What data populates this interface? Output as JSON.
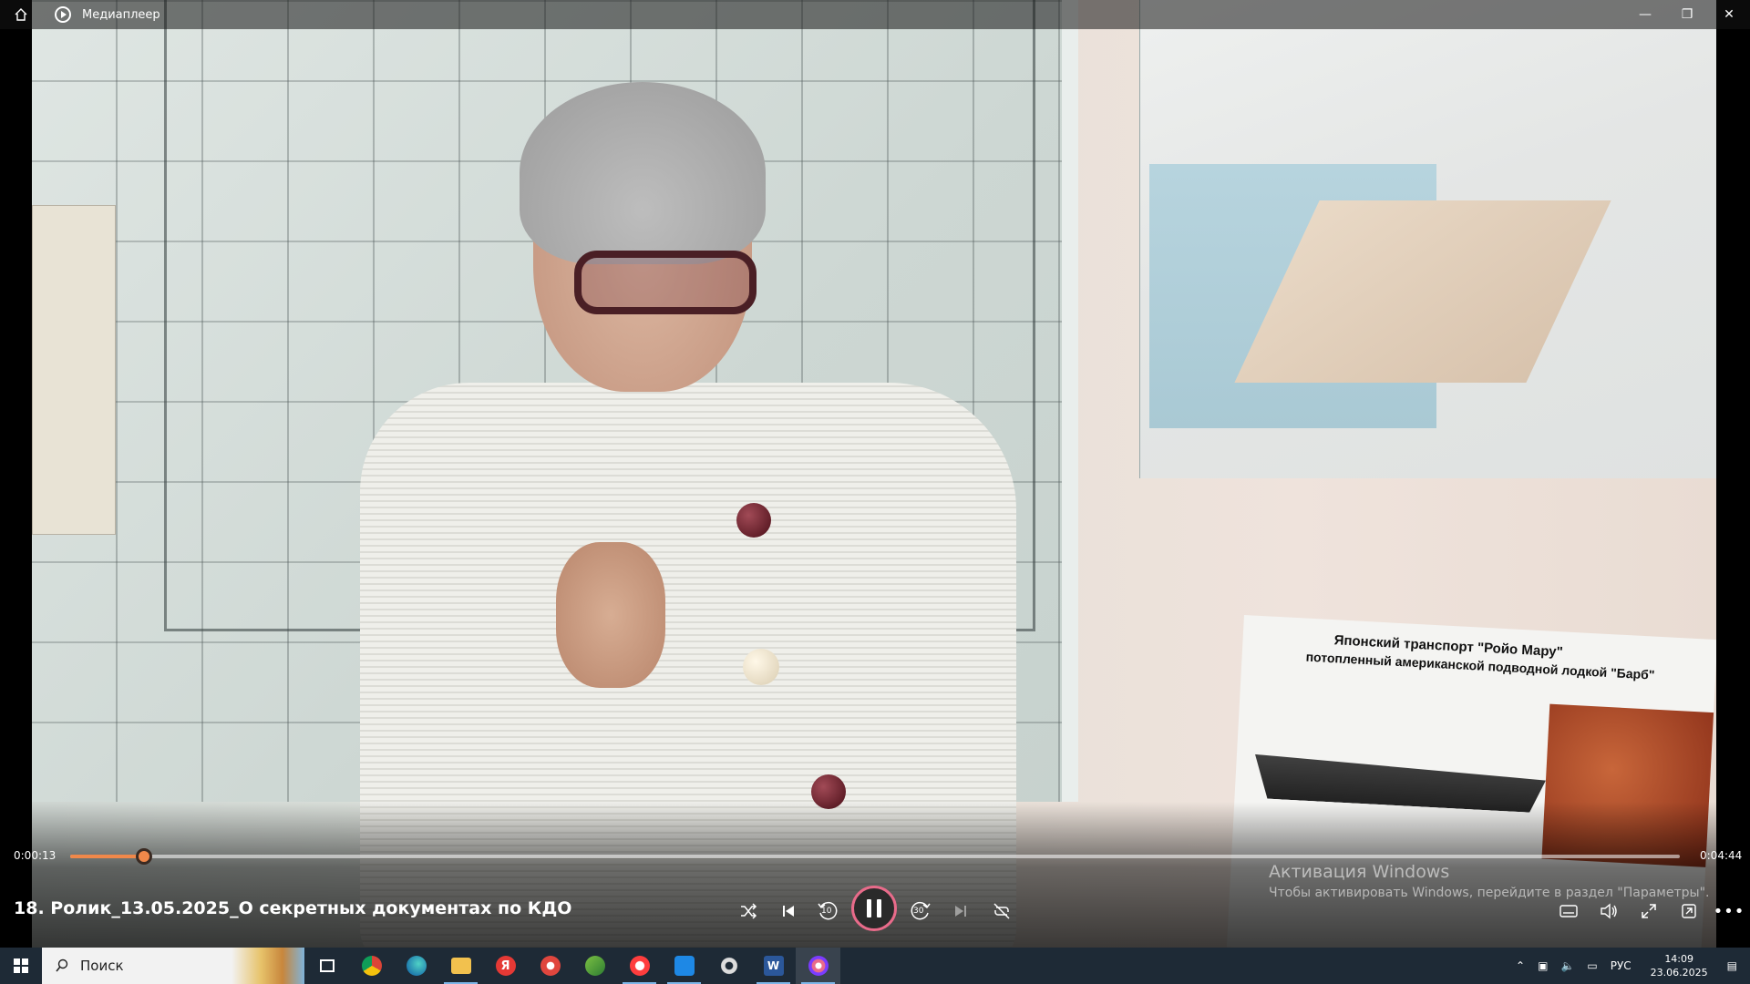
{
  "window": {
    "app_title": "Медиаплеер",
    "controls": [
      "minimize",
      "restore",
      "close"
    ]
  },
  "player": {
    "current_time": "0:00:13",
    "total_time": "0:04:44",
    "progress": 0.046,
    "media_title": "18. Ролик_13.05.2025_О секретных документах по КДО",
    "state": "playing",
    "accent_color": "#f0884a",
    "play_ring_color": "#e86b8a"
  },
  "controls": {
    "shuffle_icon": "shuffle-icon",
    "previous_icon": "previous-icon",
    "rewind_label": "10",
    "forward_label": "30",
    "next_icon": "next-icon",
    "repeat_icon": "repeat-off-icon",
    "right_icons": [
      "subtitles-icon",
      "volume-icon",
      "fullscreen-icon",
      "miniplayer-icon",
      "more-icon"
    ]
  },
  "watermark": {
    "title": "Активация Windows",
    "subtitle": "Чтобы активировать Windows, перейдите в раздел \"Параметры\"."
  },
  "video_text": {
    "poster_line1": "Японский транспорт \"Ройо Мару\"",
    "poster_line2": "потопленный американской подводной лодкой \"Барб\""
  },
  "taskbar": {
    "search_label": "Поиск",
    "apps": [
      "task-view",
      "chrome",
      "edge",
      "file-explorer",
      "yandex",
      "app-red",
      "app-green",
      "yandex-browser",
      "app-blue",
      "app-gear",
      "word",
      "media-player"
    ],
    "active_app": "media-player",
    "language": "РУС",
    "time": "14:09",
    "date": "23.06.2025"
  }
}
